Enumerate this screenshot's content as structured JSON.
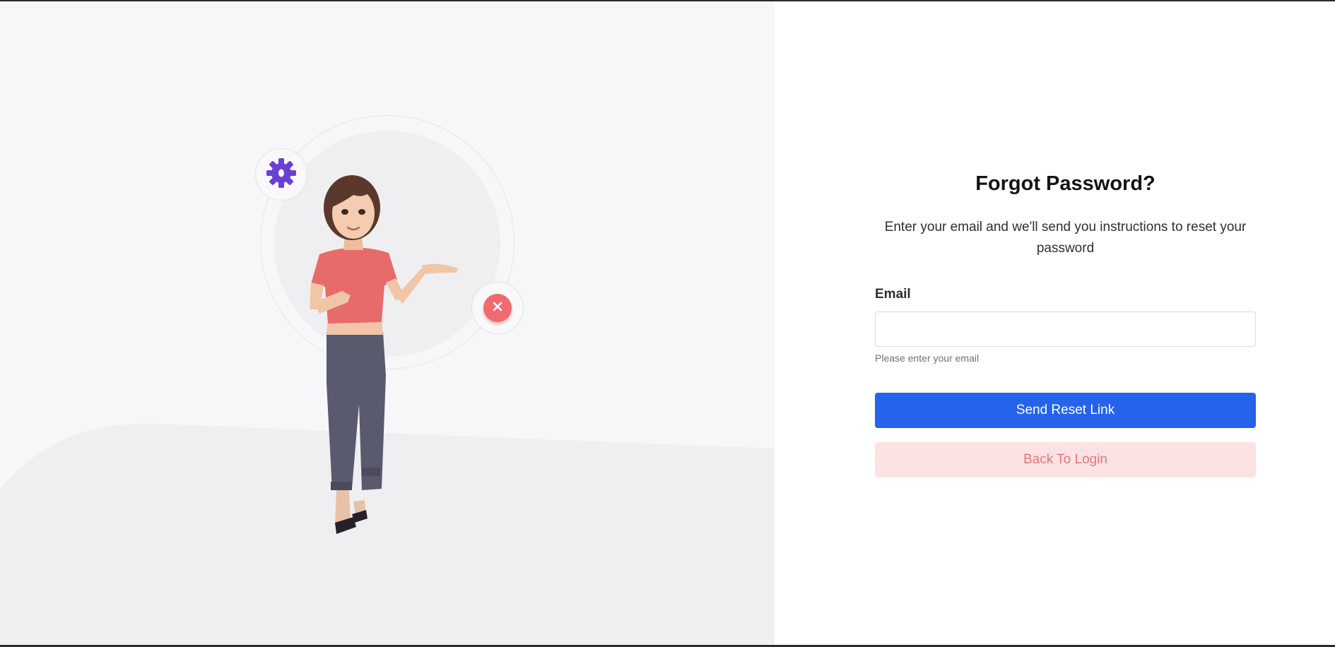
{
  "illustration": {
    "gear_icon": "gear-icon",
    "close_icon": "close-icon",
    "colors": {
      "panel_background": "#f7f7f9",
      "floor": "#efeff2",
      "gear": "#6a3fd6",
      "close_badge": "#f16a6f",
      "shirt": "#e86b6b",
      "pants": "#5a5a6e"
    }
  },
  "form": {
    "title": "Forgot Password?",
    "subtitle": "Enter your email and we'll send you instructions to reset your password",
    "email_label": "Email",
    "email_value": "",
    "email_placeholder": "",
    "email_hint": "Please enter your email",
    "submit_label": "Send Reset Link",
    "back_label": "Back To Login",
    "colors": {
      "primary": "#2563eb",
      "secondary_bg": "#fde2e3",
      "secondary_text": "#e0787f"
    }
  }
}
